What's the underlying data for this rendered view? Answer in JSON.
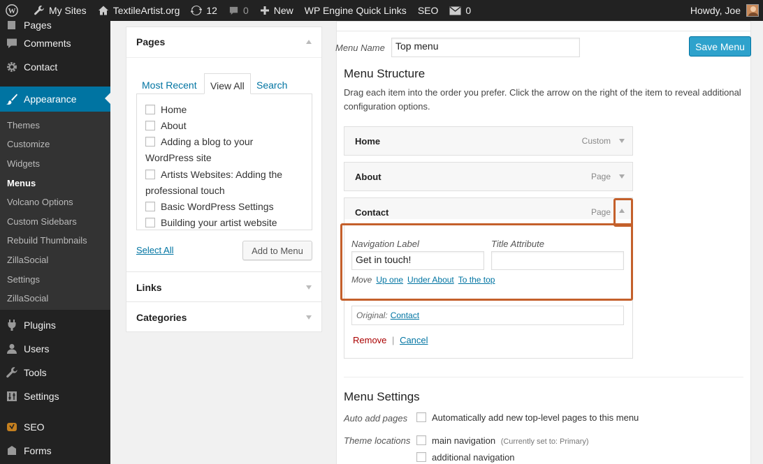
{
  "adminbar": {
    "my_sites": "My Sites",
    "site_name": "TextileArtist.org",
    "updates_count": "12",
    "comments_count": "0",
    "new_label": "New",
    "wp_engine": "WP Engine Quick Links",
    "seo": "SEO",
    "messages_count": "0",
    "howdy": "Howdy, Joe"
  },
  "sidebar": {
    "pages_partial": "Pages",
    "comments": "Comments",
    "contact": "Contact",
    "appearance": "Appearance",
    "submenu": [
      "Themes",
      "Customize",
      "Widgets",
      "Menus",
      "Volcano Options",
      "Custom Sidebars",
      "Rebuild Thumbnails",
      "ZillaSocial",
      "Settings",
      "ZillaSocial"
    ],
    "plugins": "Plugins",
    "users": "Users",
    "tools": "Tools",
    "settings": "Settings",
    "seo": "SEO",
    "forms": "Forms"
  },
  "pages_box": {
    "title": "Pages",
    "tabs": [
      "Most Recent",
      "View All",
      "Search"
    ],
    "active_tab": "View All",
    "items": [
      "Home",
      "About",
      "Adding a blog to your WordPress site",
      "Artists Websites: Adding the professional touch",
      "Basic WordPress Settings",
      "Building your artist website"
    ],
    "select_all": "Select All",
    "add_to_menu": "Add to Menu"
  },
  "links_box": {
    "title": "Links"
  },
  "categories_box": {
    "title": "Categories"
  },
  "menu": {
    "name_label": "Menu Name",
    "name_value": "Top menu",
    "save_button": "Save Menu",
    "structure_title": "Menu Structure",
    "structure_desc": "Drag each item into the order you prefer. Click the arrow on the right of the item to reveal additional configuration options.",
    "items": [
      {
        "title": "Home",
        "type": "Custom"
      },
      {
        "title": "About",
        "type": "Page"
      },
      {
        "title": "Contact",
        "type": "Page"
      }
    ],
    "edit": {
      "nav_label": "Navigation Label",
      "nav_value": "Get in touch!",
      "title_attr_label": "Title Attribute",
      "title_attr_value": "",
      "move_label": "Move",
      "move_up": "Up one",
      "move_under": "Under About",
      "move_top": "To the top",
      "original_label": "Original:",
      "original_link": "Contact",
      "remove": "Remove",
      "separator": "|",
      "cancel": "Cancel"
    },
    "settings_title": "Menu Settings",
    "auto_add_label": "Auto add pages",
    "auto_add_text": "Automatically add new top-level pages to this menu",
    "theme_locations_label": "Theme locations",
    "location_main": "main navigation",
    "location_main_note": "(Currently set to: Primary)",
    "location_additional": "additional navigation"
  },
  "colors": {
    "accent": "#0074a2",
    "primary_button": "#2ea2cc",
    "highlight": "#c4602b",
    "remove": "#a00"
  }
}
